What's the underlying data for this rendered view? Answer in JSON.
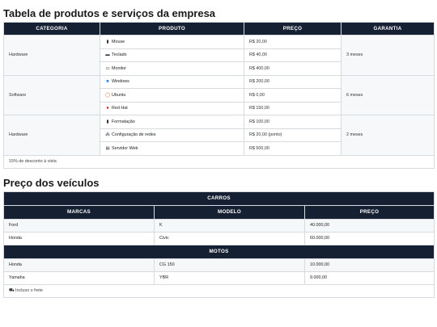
{
  "products": {
    "title": "Tabela de produtos e serviços da empresa",
    "headers": [
      "CATEGORIA",
      "PRODUTO",
      "PREÇO",
      "GARANTIA"
    ],
    "groups": [
      {
        "category": "Hardware",
        "warranty": "3 meses",
        "items": [
          {
            "icon": "mouse-icon",
            "name": "Mouse",
            "price": "R$ 20,00"
          },
          {
            "icon": "keyboard-icon",
            "name": "Teclado",
            "price": "R$ 40,00"
          },
          {
            "icon": "monitor-icon",
            "name": "Monitor",
            "price": "R$ 400,00"
          }
        ]
      },
      {
        "category": "Software",
        "warranty": "6 meses",
        "items": [
          {
            "icon": "windows-icon",
            "name": "Windows",
            "price": "R$ 200,00"
          },
          {
            "icon": "ubuntu-icon",
            "name": "Ubuntu",
            "price": "R$ 0,00"
          },
          {
            "icon": "redhat-icon",
            "name": "Red Hat",
            "price": "R$ 150,00"
          }
        ]
      },
      {
        "category": "Hardware",
        "warranty": "2 meses",
        "items": [
          {
            "icon": "clipboard-icon",
            "name": "Formatação",
            "price": "R$ 100,00"
          },
          {
            "icon": "network-icon",
            "name": "Configuração de redes",
            "price": "R$ 20,00 (ponto)"
          },
          {
            "icon": "server-icon",
            "name": "Servidor Web",
            "price": "R$ 500,00"
          }
        ]
      }
    ],
    "footer": "15% de desconto à vista"
  },
  "vehicles": {
    "title": "Preço dos veículos",
    "section_cars": "CARROS",
    "headers": [
      "MARCAS",
      "MODELO",
      "PREÇO"
    ],
    "cars": [
      {
        "brand": "Ford",
        "model": "K",
        "price": "40.000,00"
      },
      {
        "brand": "Honda",
        "model": "Civic",
        "price": "60.000,00"
      }
    ],
    "section_motos": "MOTOS",
    "motos": [
      {
        "brand": "Honda",
        "model": "CG 150",
        "price": "10.000,00"
      },
      {
        "brand": "Yamaha",
        "model": "YBR",
        "price": "9.000,00"
      }
    ],
    "footer": "Incluso o frete",
    "footer_icon": "truck-icon"
  }
}
